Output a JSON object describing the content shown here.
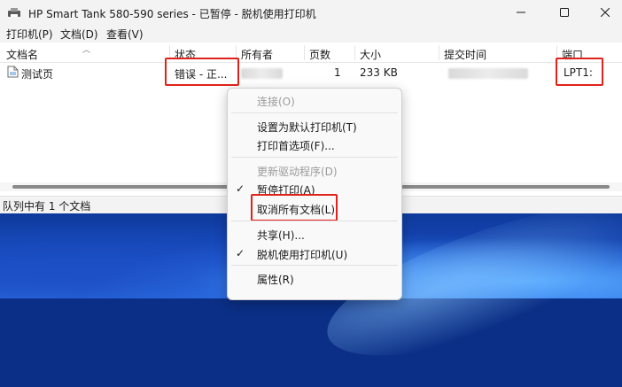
{
  "window": {
    "title": "HP Smart Tank 580-590 series - 已暂停 - 脱机使用打印机"
  },
  "menubar": {
    "items": [
      "打印机(P)",
      "文档(D)",
      "查看(V)"
    ]
  },
  "table": {
    "columns": [
      "文档名",
      "状态",
      "所有者",
      "页数",
      "大小",
      "提交时间",
      "端口"
    ],
    "rows": [
      {
        "name": "测试页",
        "status": "错误 - 正...",
        "owner": "",
        "pages": "1",
        "size": "233 KB",
        "submitted": "",
        "port": "LPT1:"
      }
    ]
  },
  "status": {
    "text": "队列中有 1 个文档"
  },
  "context_menu": {
    "items": [
      {
        "label": "连接(O)",
        "disabled": true,
        "checked": false
      },
      {
        "label": "设置为默认打印机(T)",
        "disabled": false,
        "checked": false
      },
      {
        "label": "打印首选项(F)...",
        "disabled": false,
        "checked": false
      },
      {
        "label": "更新驱动程序(D)",
        "disabled": true,
        "checked": false
      },
      {
        "label": "暂停打印(A)",
        "disabled": false,
        "checked": true
      },
      {
        "label": "取消所有文档(L)",
        "disabled": false,
        "checked": false
      },
      {
        "label": "共享(H)...",
        "disabled": false,
        "checked": false
      },
      {
        "label": "脱机使用打印机(U)",
        "disabled": false,
        "checked": true
      },
      {
        "label": "属性(R)",
        "disabled": false,
        "checked": false
      }
    ],
    "check_glyph": "✓"
  },
  "icons": {
    "app": "printer-icon",
    "document": "document-icon",
    "minimize": "minimize-icon",
    "maximize": "maximize-icon",
    "close": "close-icon",
    "sort": "sort-up-icon"
  },
  "colors": {
    "highlight": "#e0231a",
    "disabled_text": "#9b9b9b"
  }
}
